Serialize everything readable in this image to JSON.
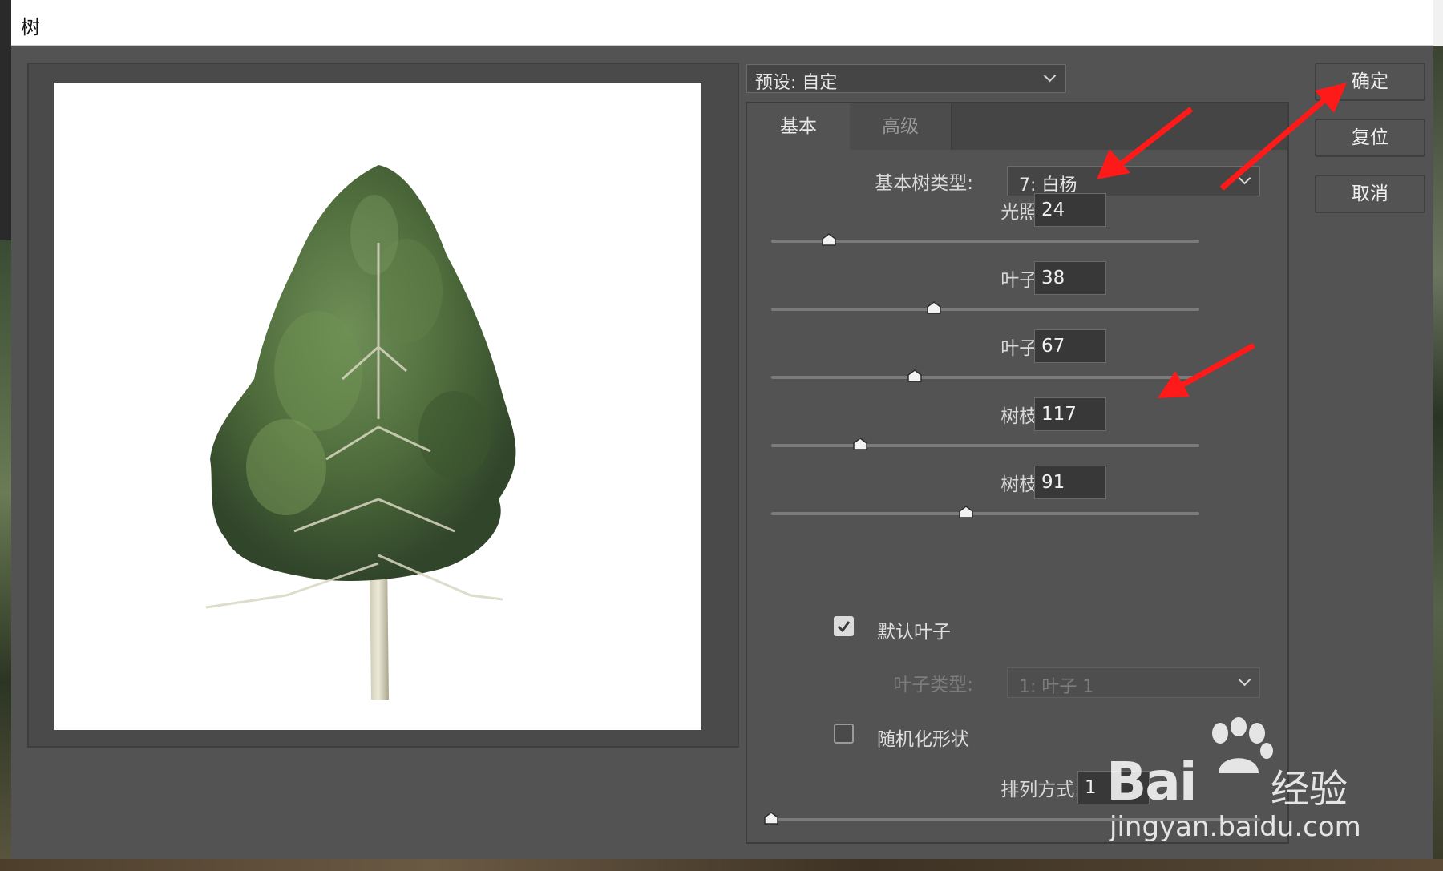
{
  "window": {
    "title": "树"
  },
  "preset": {
    "label": "预设: 自定"
  },
  "tabs": [
    {
      "label": "基本",
      "active": true
    },
    {
      "label": "高级",
      "active": false
    }
  ],
  "tree_type": {
    "label": "基本树类型:",
    "value": "7: 白杨"
  },
  "sliders": [
    {
      "label": "光照方向:",
      "value": "24",
      "fraction": 0.135
    },
    {
      "label": "叶子数量:",
      "value": "38",
      "fraction": 0.38
    },
    {
      "label": "叶子大小:",
      "value": "67",
      "fraction": 0.335
    },
    {
      "label": "树枝高度:",
      "value": "117",
      "fraction": 0.208
    },
    {
      "label": "树枝粗细:",
      "value": "91",
      "fraction": 0.455
    }
  ],
  "default_leaves": {
    "label": "默认叶子",
    "checked": true
  },
  "leaf_type": {
    "label": "叶子类型:",
    "value": "1: 叶子 1",
    "disabled": true
  },
  "randomize": {
    "label": "随机化形状",
    "checked": false
  },
  "arrangement": {
    "label": "排列方式:",
    "value": "1",
    "fraction": 0.0
  },
  "buttons": {
    "ok": "确定",
    "reset": "复位",
    "cancel": "取消"
  },
  "watermark": {
    "brand": "Bai",
    "brand2": "经验",
    "url": "jingyan.baidu.com"
  },
  "colors": {
    "annotation_arrow": "#ff1a1a",
    "dialog_bg": "#535353"
  }
}
